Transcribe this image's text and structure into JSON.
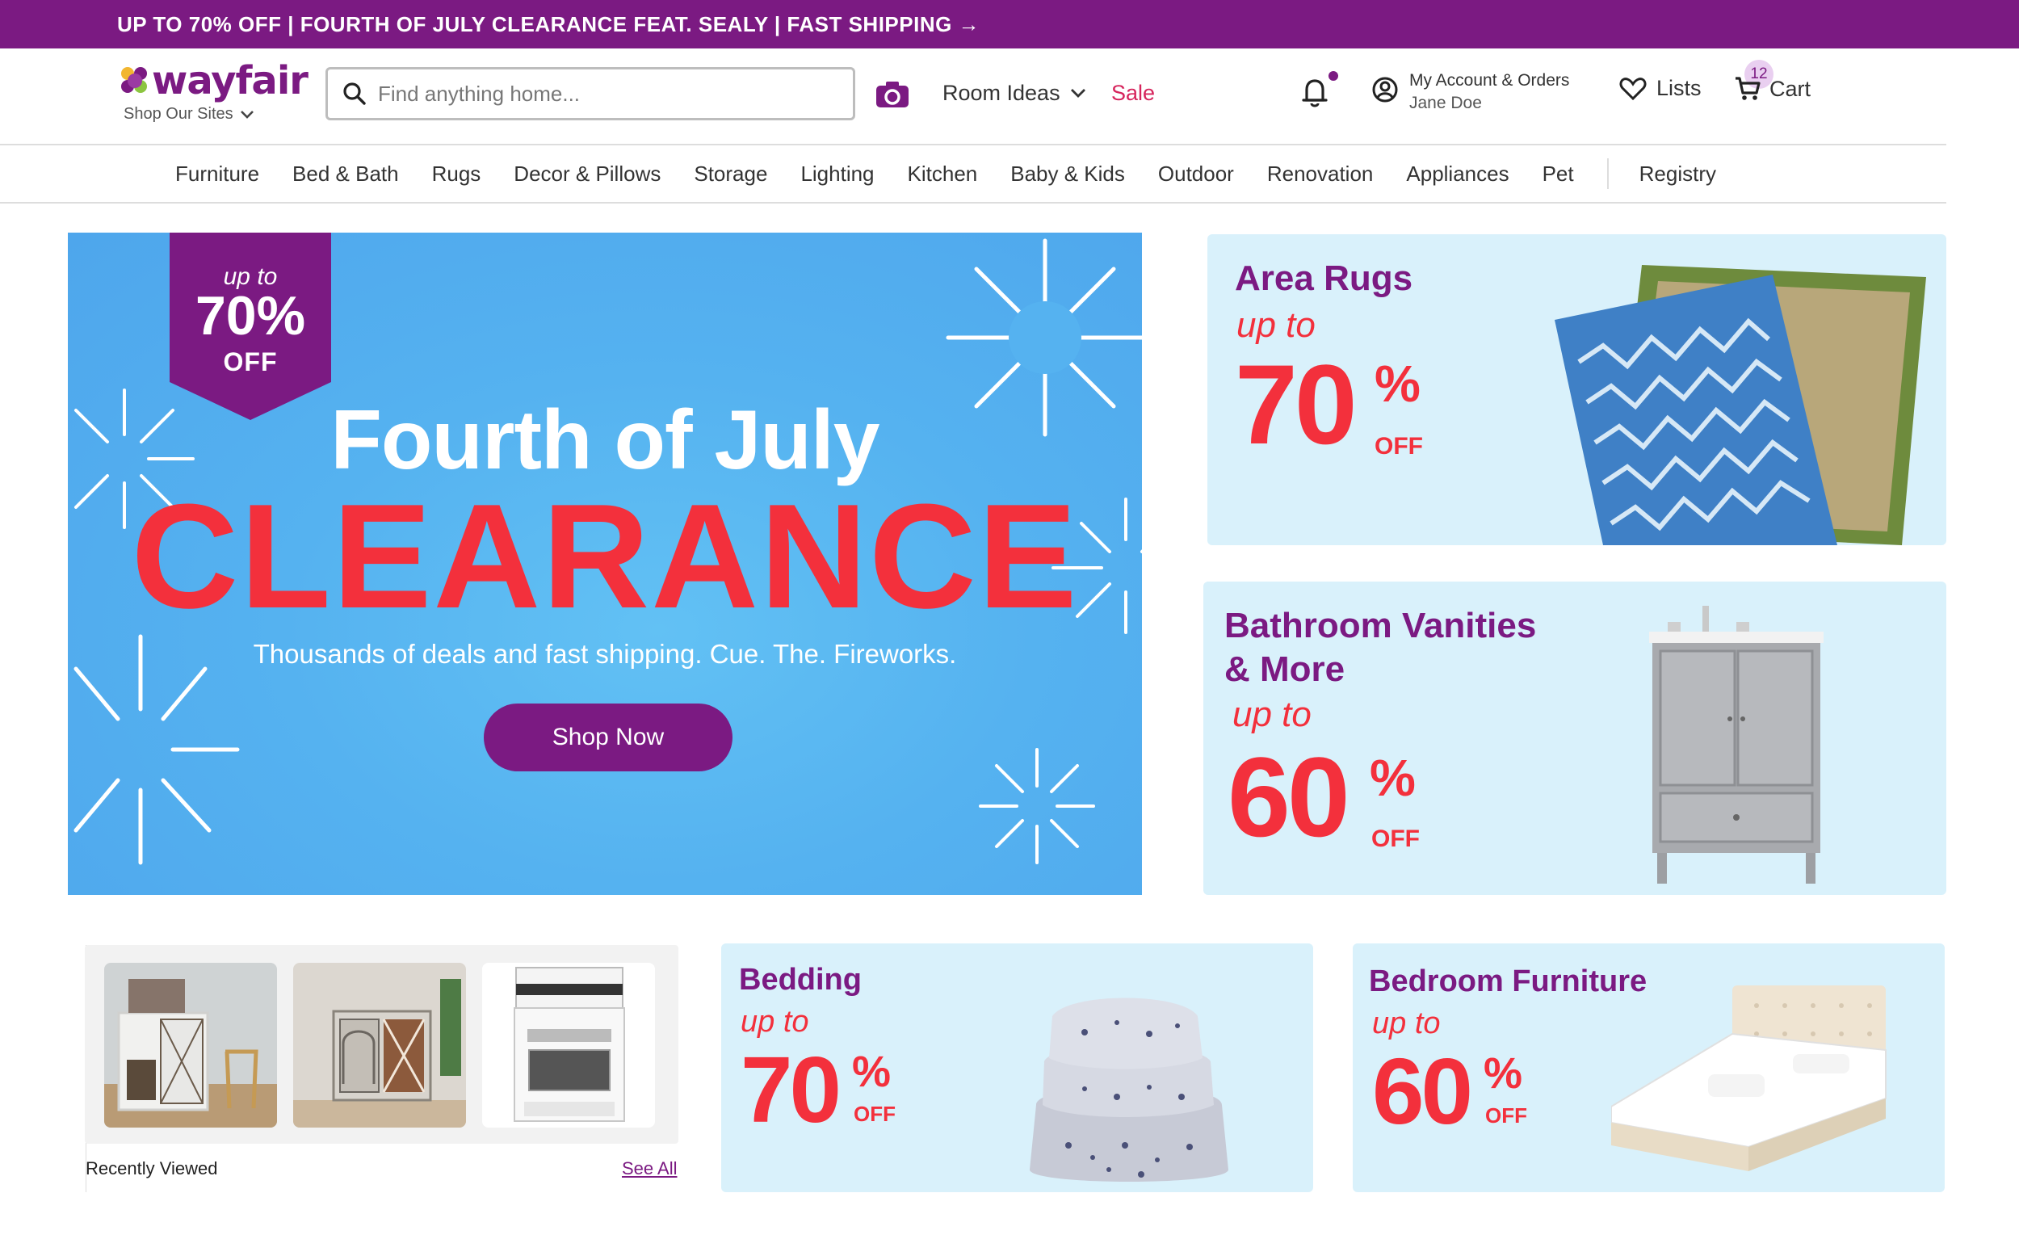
{
  "promo_bar": {
    "text": "UP TO 70% OFF | FOURTH OF JULY CLEARANCE FEAT. SEALY | FAST SHIPPING →"
  },
  "header": {
    "logo": "wayfair",
    "shop_sites": "Shop Our Sites",
    "search_placeholder": "Find anything home...",
    "room_ideas": "Room Ideas",
    "sale": "Sale",
    "account_title": "My Account & Orders",
    "account_name": "Jane Doe",
    "lists": "Lists",
    "cart": "Cart",
    "cart_count": "12"
  },
  "categories": [
    "Furniture",
    "Bed & Bath",
    "Rugs",
    "Decor & Pillows",
    "Storage",
    "Lighting",
    "Kitchen",
    "Baby & Kids",
    "Outdoor",
    "Renovation",
    "Appliances",
    "Pet"
  ],
  "registry": "Registry",
  "hero": {
    "badge_up_to": "up to",
    "badge_pct": "70%",
    "badge_off": "OFF",
    "title": "Fourth of July",
    "headline": "CLEARANCE",
    "subtitle": "Thousands of deals and fast shipping. Cue. The. Fireworks.",
    "cta": "Shop Now"
  },
  "tiles": {
    "rugs": {
      "title": "Area Rugs",
      "up_to": "up to",
      "number": "70",
      "pct": "%",
      "off": "OFF"
    },
    "vanities": {
      "title_line1": "Bathroom Vanities",
      "title_line2": "& More",
      "up_to": "up to",
      "number": "60",
      "pct": "%",
      "off": "OFF"
    },
    "bedding": {
      "title": "Bedding",
      "up_to": "up to",
      "number": "70",
      "pct": "%",
      "off": "OFF"
    },
    "bedroom": {
      "title": "Bedroom Furniture",
      "up_to": "up to",
      "number": "60",
      "pct": "%",
      "off": "OFF"
    }
  },
  "recently_viewed": {
    "title": "Recently Viewed",
    "see_all": "See All"
  },
  "colors": {
    "brand_purple": "#7b1a82",
    "sale_red": "#f3303c",
    "tile_bg": "#d9f1fb",
    "hero_blue": "#55b2f0"
  }
}
